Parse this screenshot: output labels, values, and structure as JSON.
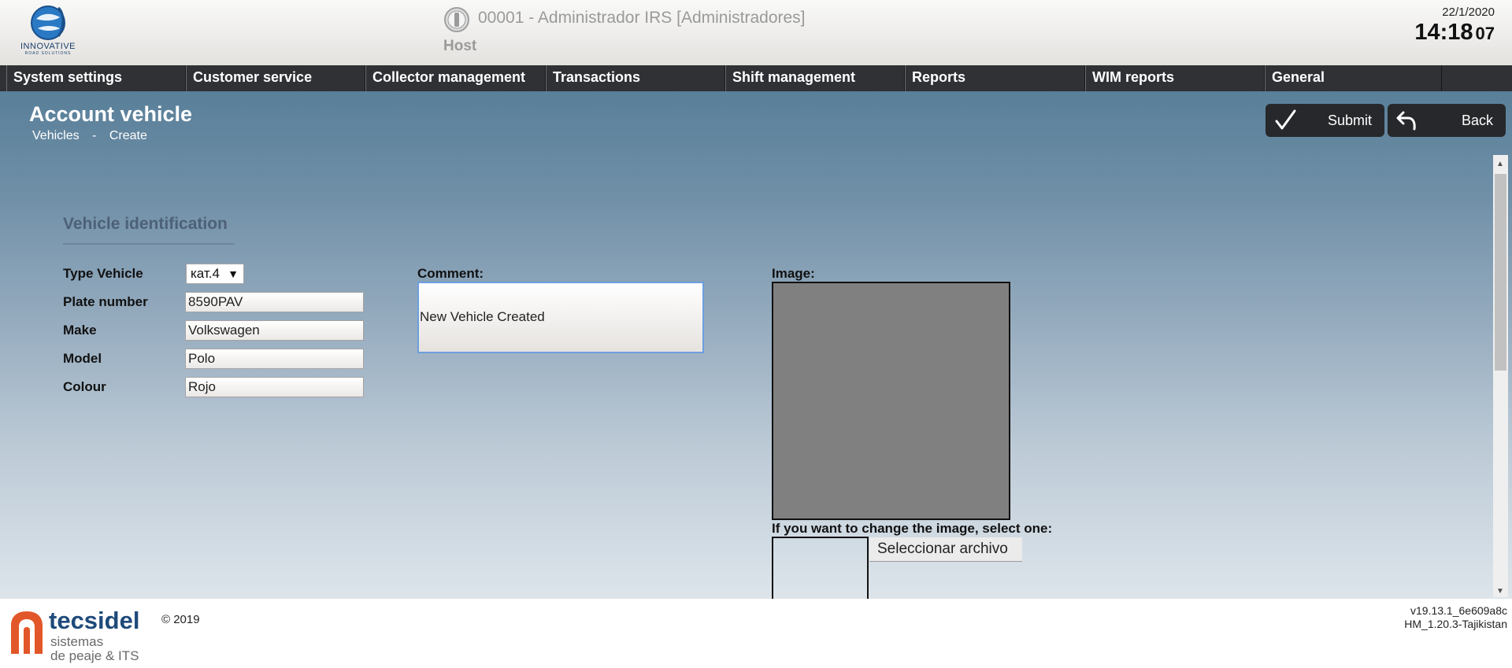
{
  "header": {
    "logo_text": "INNOVATIVE",
    "logo_subtext": "ROAD SOLUTIONS",
    "user_info": "00001 - Administrador IRS [Administradores]",
    "host_label": "Host",
    "date": "22/1/2020",
    "time_hm": "14:18",
    "time_sec": "07"
  },
  "menu": [
    {
      "label": "System settings"
    },
    {
      "label": "Customer service"
    },
    {
      "label": "Collector management"
    },
    {
      "label": "Transactions"
    },
    {
      "label": "Shift management"
    },
    {
      "label": "Reports"
    },
    {
      "label": "WIM reports"
    },
    {
      "label": "General"
    }
  ],
  "page": {
    "title": "Account vehicle",
    "breadcrumb": [
      "Vehicles",
      "-",
      "Create"
    ],
    "submit_label": "Submit",
    "back_label": "Back"
  },
  "form": {
    "section_title": "Vehicle identification",
    "type_label": "Type Vehicle",
    "type_value": "кат.4",
    "plate_label": "Plate number",
    "plate_value": "8590PAV",
    "make_label": "Make",
    "make_value": "Volkswagen",
    "model_label": "Model",
    "model_value": "Polo",
    "colour_label": "Colour",
    "colour_value": "Rojo",
    "comment_label": "Comment:",
    "comment_value": "New Vehicle Created",
    "image_label": "Image:",
    "change_image_label": "If you want to change the image, select one:",
    "file_button_label": "Seleccionar archivo"
  },
  "footer": {
    "brand": "tecsidel",
    "brand_sub1": "sistemas",
    "brand_sub2": "de peaje & ITS",
    "copyright": "© 2019",
    "version": "v19.13.1_6e609a8c",
    "build": "HM_1.20.3-Tajikistan"
  },
  "colors": {
    "menu_bg": "#2f3135",
    "accent_blue": "#1e4a7a",
    "brand_orange": "#e2572a",
    "focus_border": "#6d9ee0"
  },
  "icons": [
    "globe-logo-icon",
    "power-icon",
    "checkmark-icon",
    "back-arrow-icon",
    "scroll-up-icon",
    "scroll-down-icon",
    "tecsidel-logo-icon"
  ]
}
